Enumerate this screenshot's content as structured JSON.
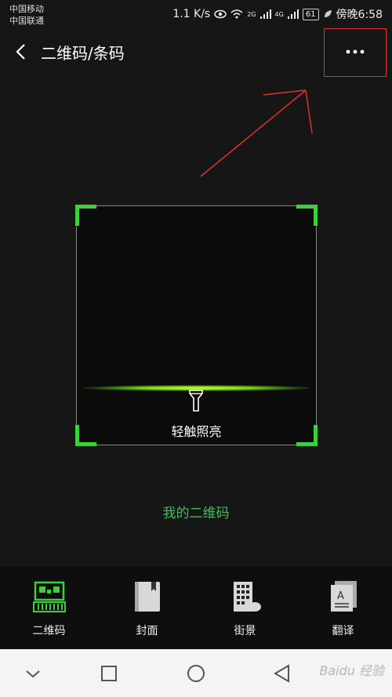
{
  "status": {
    "carrier1": "中国移动",
    "carrier2": "中国联通",
    "speed": "1.1 K/s",
    "sig1_label": "2G",
    "sig2_label": "4G",
    "battery": "61",
    "time": "傍晚6:58"
  },
  "header": {
    "title": "二维码/条码"
  },
  "scanner": {
    "torch_label": "轻触照亮",
    "accent_color": "#3cd13c"
  },
  "my_qr": {
    "label": "我的二维码",
    "color": "#3fbf5a"
  },
  "tabs": [
    {
      "label": "二维码",
      "icon": "qr-code-icon",
      "active": true
    },
    {
      "label": "封面",
      "icon": "book-cover-icon",
      "active": false
    },
    {
      "label": "街景",
      "icon": "street-view-icon",
      "active": false
    },
    {
      "label": "翻译",
      "icon": "translate-icon",
      "active": false
    }
  ],
  "watermark": "Baidu 经验",
  "annotation_color": "#e0302e"
}
